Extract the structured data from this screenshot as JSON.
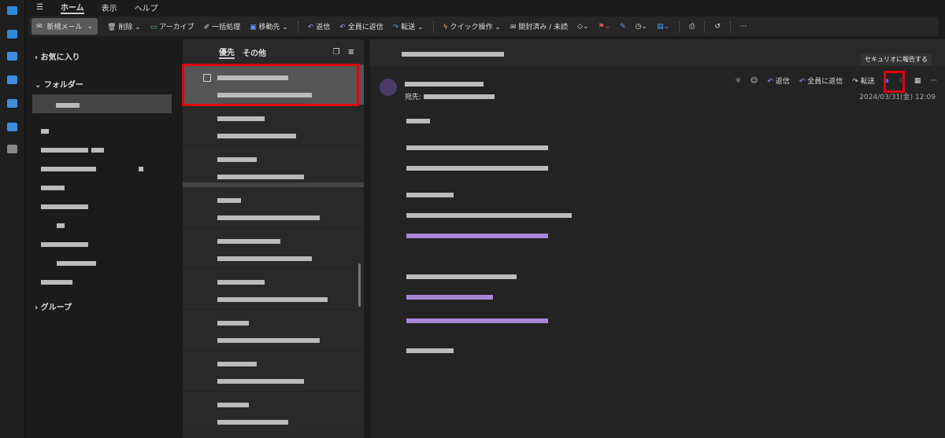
{
  "menu": {
    "tabs": [
      "ホーム",
      "表示",
      "ヘルプ"
    ]
  },
  "ribbon": {
    "new_mail": "新規メール",
    "delete": "削除",
    "archive": "アーカイブ",
    "sweep": "一括処理",
    "move": "移動先",
    "reply": "返信",
    "reply_all": "全員に返信",
    "forward": "転送",
    "quick_steps": "クイック操作",
    "read_unread": "開封済み / 未読"
  },
  "folders": {
    "favorites": "お気に入り",
    "folders": "フォルダー",
    "groups": "グループ"
  },
  "list": {
    "tab_focused": "優先",
    "tab_other": "その他"
  },
  "reading": {
    "to_label": "宛先:",
    "reply": "返信",
    "reply_all": "全員に返信",
    "forward": "転送",
    "date": "2024/03/31(金) 12:09",
    "tooltip": "セキュリオに報告する"
  }
}
